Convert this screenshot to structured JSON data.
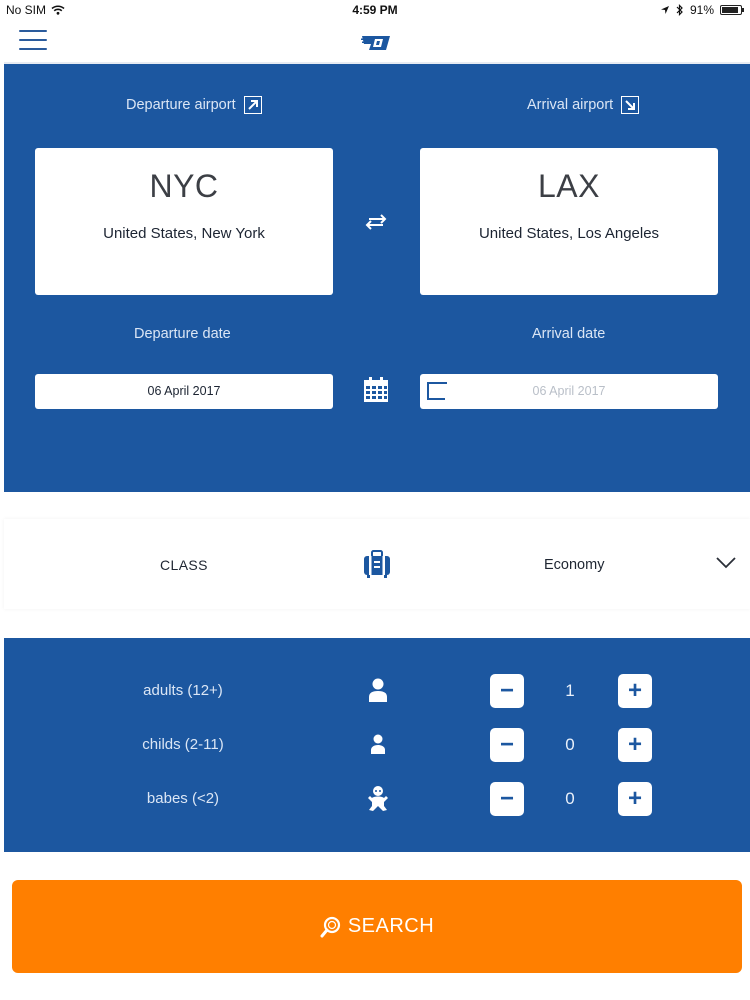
{
  "status_bar": {
    "carrier": "No SIM",
    "time": "4:59 PM",
    "battery": "91%",
    "battery_level": 0.91
  },
  "header": {
    "menu_icon": "hamburger-icon",
    "logo_icon": "airline-logo"
  },
  "route": {
    "departure_label": "Departure airport",
    "arrival_label": "Arrival airport",
    "departure": {
      "code": "NYC",
      "city": "United States, New York"
    },
    "arrival": {
      "code": "LAX",
      "city": "United States, Los Angeles"
    },
    "swap_icon": "swap-arrows-icon"
  },
  "dates": {
    "departure_label": "Departure date",
    "arrival_label": "Arrival date",
    "departure_value": "06 April 2017",
    "arrival_value": "06 April 2017",
    "calendar_icon": "calendar-icon"
  },
  "travel_class": {
    "label": "CLASS",
    "value": "Economy",
    "icon": "luggage-icon"
  },
  "passengers": [
    {
      "label": "adults (12+)",
      "count": "1",
      "icon": "adult-icon"
    },
    {
      "label": "childs (2-11)",
      "count": "0",
      "icon": "child-icon"
    },
    {
      "label": "babes (<2)",
      "count": "0",
      "icon": "baby-icon"
    }
  ],
  "search": {
    "label": "SEARCH"
  },
  "colors": {
    "primary_blue": "#1c57a0",
    "search_orange": "#ff7f00"
  }
}
